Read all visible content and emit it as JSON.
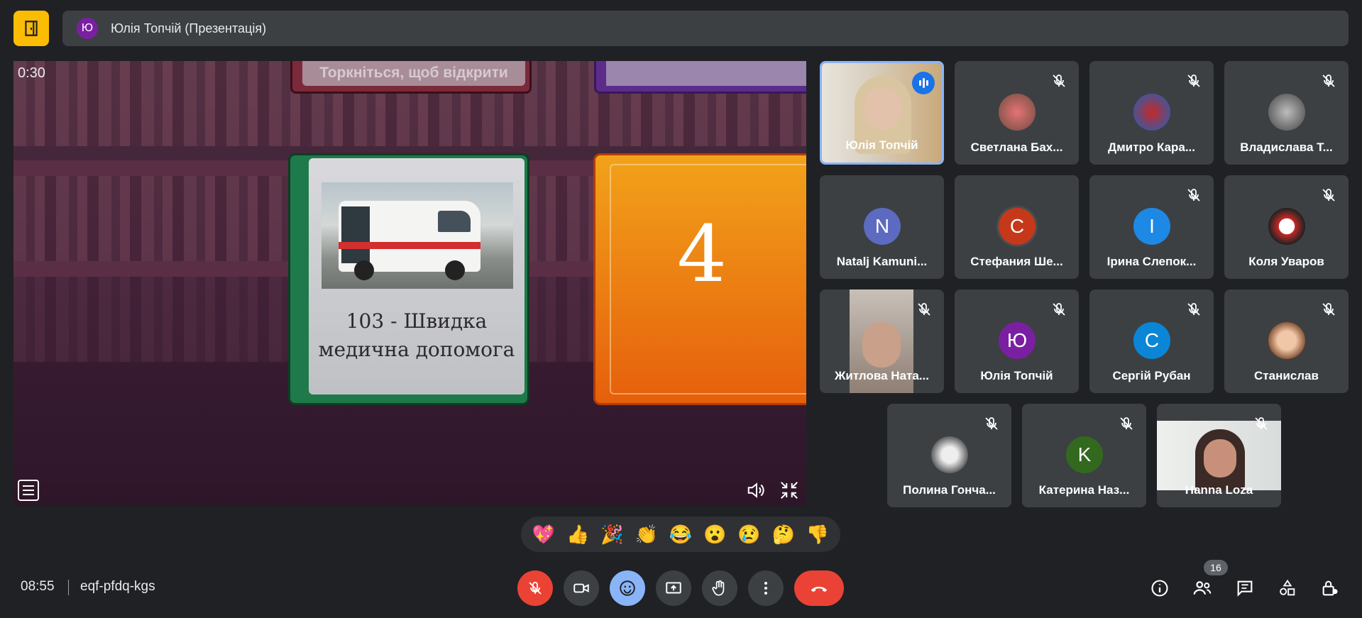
{
  "header": {
    "presenter_initial": "Ю",
    "title": "Юлія Топчій (Презентація)"
  },
  "presentation": {
    "timer": "0:30",
    "top_book_text": "Торкніться, щоб відкрити",
    "card_caption_line1": "103 - Швидка",
    "card_caption_line2": "медична допомога",
    "card_number": "4"
  },
  "participants": [
    {
      "name": "Юлія Топчій",
      "type": "video",
      "speaking": true
    },
    {
      "name": "Светлана Бах...",
      "type": "photo",
      "muted": true
    },
    {
      "name": "Дмитро Кара...",
      "type": "photo",
      "muted": true
    },
    {
      "name": "Владислава Т...",
      "type": "photo",
      "muted": true
    },
    {
      "name": "Natalj Kamuni...",
      "type": "initial",
      "initial": "N",
      "color": "#5c6bc0"
    },
    {
      "name": "Стефания Ше...",
      "type": "initial",
      "initial": "C",
      "color": "#c5381a"
    },
    {
      "name": "Ірина Слепок...",
      "type": "initial",
      "initial": "I",
      "color": "#1e88e5",
      "muted": true
    },
    {
      "name": "Коля Уваров",
      "type": "photo",
      "muted": true
    },
    {
      "name": "Житлова Ната...",
      "type": "video",
      "muted": true
    },
    {
      "name": "Юлія Топчій",
      "type": "initial",
      "initial": "Ю",
      "color": "#7b1fa2",
      "muted": true
    },
    {
      "name": "Сергій Рубан",
      "type": "initial",
      "initial": "C",
      "color": "#0b86d6",
      "muted": true
    },
    {
      "name": "Станислав",
      "type": "photo",
      "muted": true
    },
    {
      "name": "Полина Гонча...",
      "type": "photo",
      "muted": true
    },
    {
      "name": "Катерина Наз...",
      "type": "initial",
      "initial": "K",
      "color": "#33691e",
      "muted": true
    },
    {
      "name": "Hanna Loza",
      "type": "video",
      "muted": true
    }
  ],
  "reactions": [
    "💖",
    "👍",
    "🎉",
    "👏",
    "😂",
    "😮",
    "😢",
    "🤔",
    "👎"
  ],
  "footer": {
    "time": "08:55",
    "meeting_code": "eqf-pfdq-kgs",
    "participant_count": "16"
  },
  "colors": {
    "leave": "#ea4335",
    "exit_button": "#fbbc04",
    "active_tile_border": "#8ab4f8"
  }
}
